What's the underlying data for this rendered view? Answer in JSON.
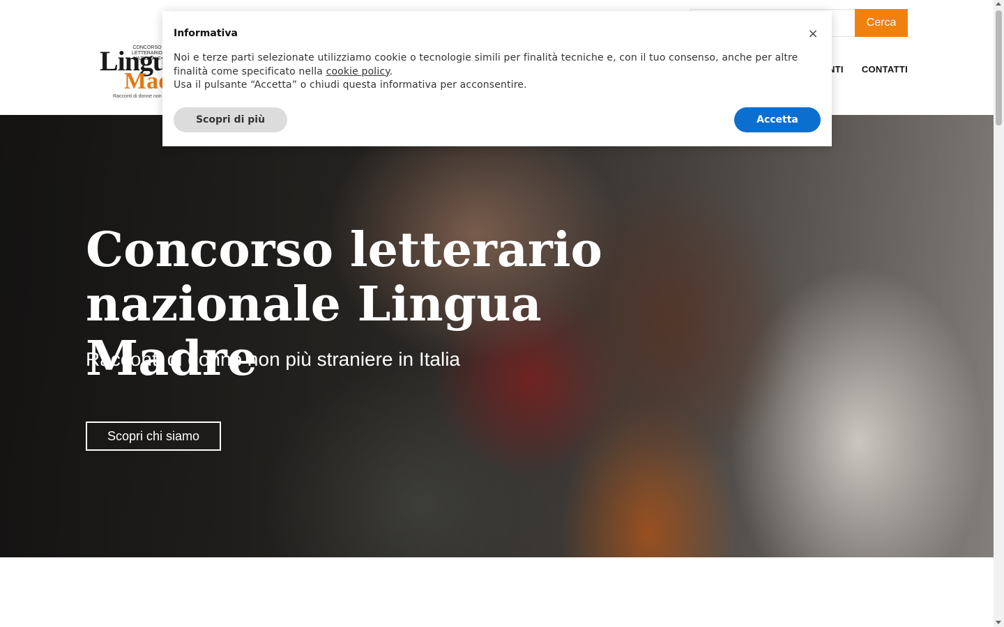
{
  "header": {
    "search": {
      "placeholder": "",
      "button_label": "Cerca"
    },
    "logo": {
      "top_text": "CONCORSO LETTERARIO NAZIONALE",
      "word1": "Lingua",
      "word2": "Madre",
      "subtitle": "Racconti di donne non più straniere in Italia"
    },
    "nav": [
      {
        "label": "EVENTI"
      },
      {
        "label": "CONTATTI"
      }
    ]
  },
  "hero": {
    "title": "Concorso letterario nazionale Lingua Madre",
    "subtitle": "Racconti di donne non più straniere in Italia",
    "cta_label": "Scopri chi siamo"
  },
  "cookie_banner": {
    "title": "Informativa",
    "text_part1": "Noi e terze parti selezionate utilizziamo cookie o tecnologie simili per finalità tecniche e, con il tuo consenso, anche per altre finalità come specificato nella ",
    "link_label": "cookie policy",
    "text_part2": ".",
    "text_line2": "Usa il pulsante “Accetta” o chiudi questa informativa per acconsentire.",
    "more_label": "Scopri di più",
    "accept_label": "Accetta",
    "close_symbol": "×"
  },
  "colors": {
    "accent_orange": "#f0810f",
    "accept_blue": "#0b6fd0",
    "logo_orange": "#e47a14"
  }
}
